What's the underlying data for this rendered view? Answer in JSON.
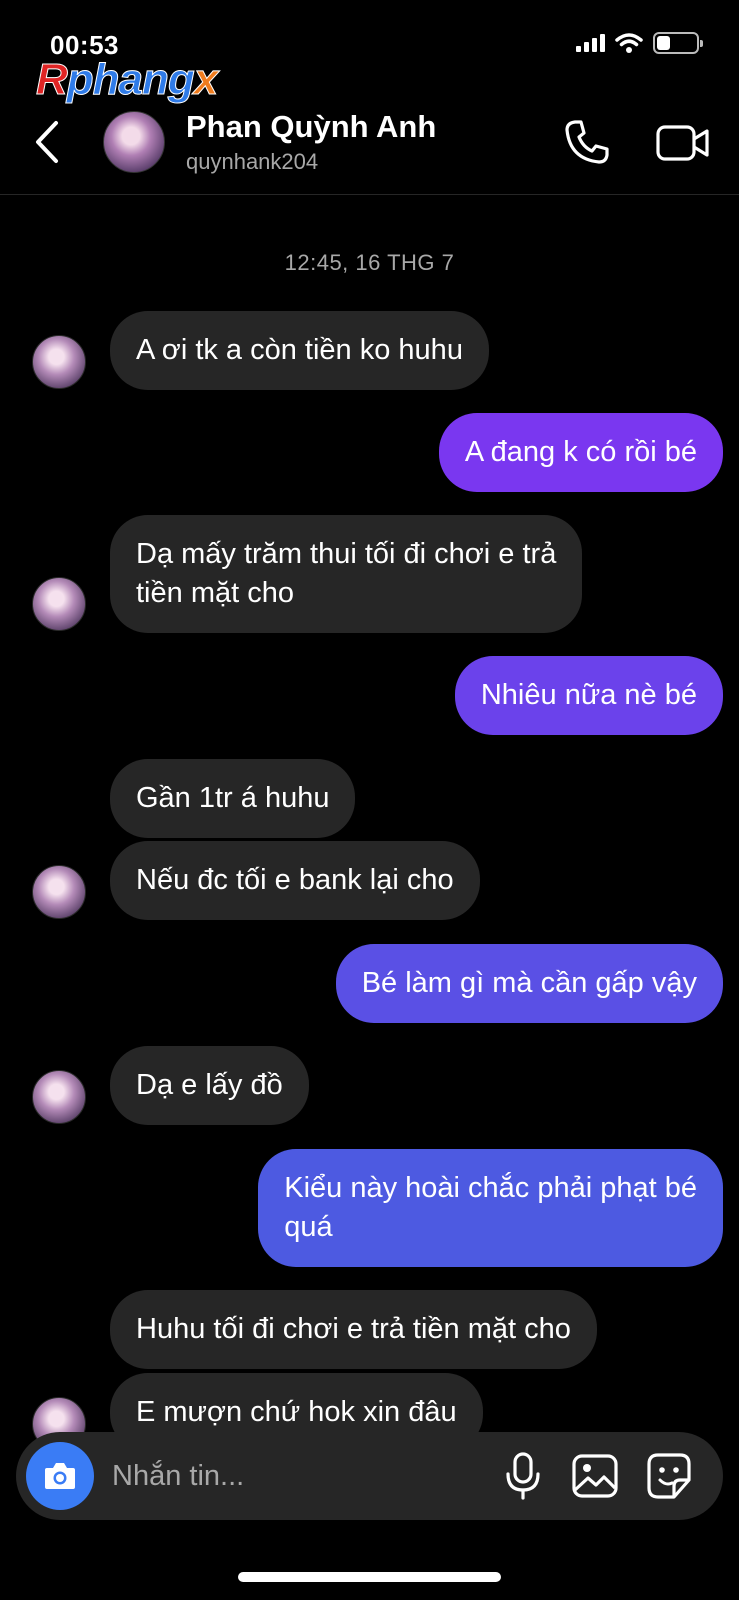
{
  "status_bar": {
    "time": "00:53",
    "battery_level": 0.35
  },
  "watermark": {
    "part1": "R",
    "part2": "phang",
    "part3": "x"
  },
  "header": {
    "name": "Phan Quỳnh Anh",
    "username": "quynhank204",
    "icons": [
      "back-chevron-icon",
      "phone-icon",
      "video-camera-icon"
    ]
  },
  "timestamp": "12:45, 16 THG 7",
  "messages": [
    {
      "from": "them",
      "text": "A ơi tk a còn tiền ko huhu"
    },
    {
      "from": "me",
      "text": "A đang k có rồi bé"
    },
    {
      "from": "them",
      "text": "Dạ mấy trăm thui tối đi chơi e trả\ntiền mặt cho"
    },
    {
      "from": "me",
      "text": "Nhiêu nữa nè bé"
    },
    {
      "from": "them",
      "text": "Gần 1tr á huhu"
    },
    {
      "from": "them",
      "text": "Nếu đc tối e bank lại cho"
    },
    {
      "from": "me",
      "text": "Bé làm gì mà cần gấp vậy"
    },
    {
      "from": "them",
      "text": "Dạ e lấy đồ"
    },
    {
      "from": "me",
      "text": "Kiểu này hoài chắc phải phạt bé\nquá"
    },
    {
      "from": "them",
      "text": "Huhu tối đi chơi e trả tiền mặt cho"
    },
    {
      "from": "them",
      "text": "E mượn chứ hok xin đâu"
    }
  ],
  "composer": {
    "placeholder": "Nhắn tin...",
    "icons": [
      "camera-icon",
      "microphone-icon",
      "gallery-icon",
      "sticker-icon"
    ]
  },
  "colors": {
    "incoming_bubble": "#262626",
    "outgoing_top": "#7b36f0",
    "outgoing_bottom": "#4a5ce0",
    "camera_button": "#3a7cf5"
  }
}
